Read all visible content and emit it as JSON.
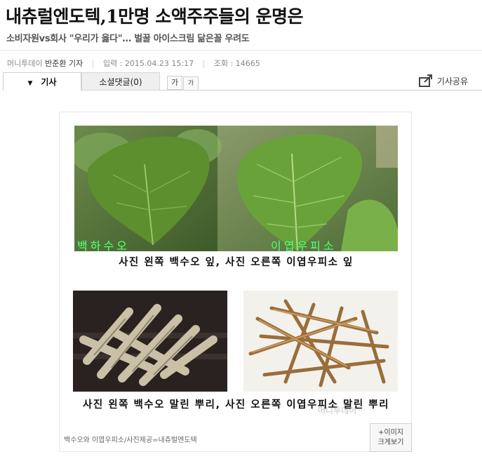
{
  "article": {
    "headline": "내츄럴엔도텍,1만명 소액주주들의 운명은",
    "subhead": "소비자원vs회사 \"우리가 옳다\"… 벌꿀 아이스크림 닮은꼴 우려도",
    "source": "머니투데이",
    "reporter": "반준환 기자",
    "input_label": "입력 : ",
    "input_date": "2015.04.23 15:17",
    "views_label": "조회 : ",
    "views": "14665"
  },
  "tabs": {
    "article": "기사",
    "social": "소셜댓글(0)"
  },
  "font_controls": {
    "larger": "가",
    "smaller": "가"
  },
  "share": {
    "label": "기사공유"
  },
  "photo": {
    "top_left_label": "백하수오",
    "top_right_label": "이엽우피소",
    "caption1": "사진 왼쪽 백수오 잎, 사진 오른쪽 이엽우피소 잎",
    "caption2": "사진 왼쪽 백수오 말린 뿌리, 사진 오른쪽 이엽우피소 말린 뿌리",
    "credit": "백수오와 이엽우피소/사진제공=내츄럴엔도텍",
    "enlarge_line1": "이미지",
    "enlarge_line2": "크게보기",
    "watermark": "머니투데이"
  }
}
